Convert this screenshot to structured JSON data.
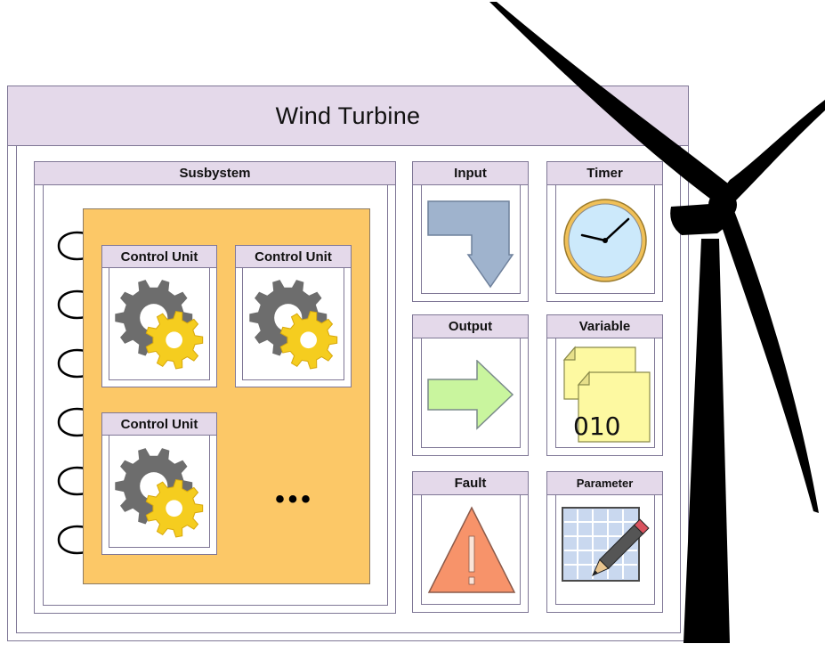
{
  "diagram": {
    "title": "Wind Turbine",
    "subsystem": {
      "title": "Susbystem",
      "control_units": [
        {
          "label": "Control Unit"
        },
        {
          "label": "Control Unit"
        },
        {
          "label": "Control Unit"
        }
      ],
      "more_indicator": "•••"
    },
    "components": {
      "input": {
        "label": "Input",
        "icon": "down-bend-arrow-icon"
      },
      "timer": {
        "label": "Timer",
        "icon": "clock-icon"
      },
      "output": {
        "label": "Output",
        "icon": "right-arrow-icon"
      },
      "variable": {
        "label": "Variable",
        "icon": "document-icon",
        "value": "010"
      },
      "fault": {
        "label": "Fault",
        "icon": "warning-icon"
      },
      "parameter": {
        "label": "Parameter",
        "icon": "grid-pencil-icon"
      }
    }
  },
  "colors": {
    "header_fill": "#e4d9ea",
    "border": "#7f7796",
    "subsystem_fill": "#fcc867",
    "gear_gray": "#6d6d6d",
    "gear_yellow": "#f5cd1f",
    "input_arrow": "#9fb3cd",
    "output_arrow": "#c9f59e",
    "clock_face": "#cce9fb",
    "clock_rim": "#f0c058",
    "note_fill": "#fdf9a1",
    "warning_fill": "#f7936a",
    "turbine": "#000000"
  }
}
